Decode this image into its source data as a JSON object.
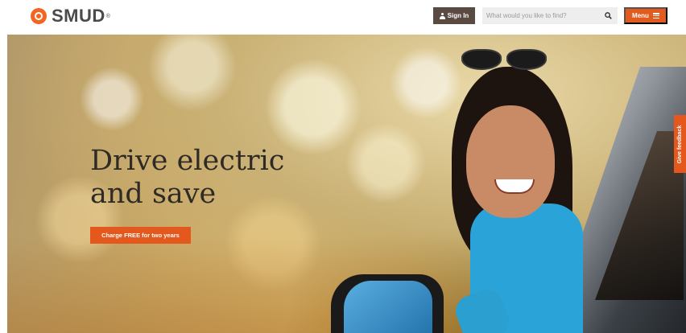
{
  "header": {
    "logo_text": "SMUD",
    "logo_mark": "®",
    "signin_label": "Sign In",
    "search_placeholder": "What would you like to find?",
    "menu_label": "Menu"
  },
  "hero": {
    "headline_line1": "Drive electric",
    "headline_line2": "and save",
    "cta_label": "Charge FREE for two years"
  },
  "feedback_label": "Give feedback",
  "icons": {
    "signin": "user-icon",
    "search": "search-icon",
    "menu": "hamburger-icon"
  },
  "colors": {
    "brand_orange": "#e4571d",
    "signin_bg": "#5a4a42",
    "logo_text": "#4a4a4a"
  }
}
